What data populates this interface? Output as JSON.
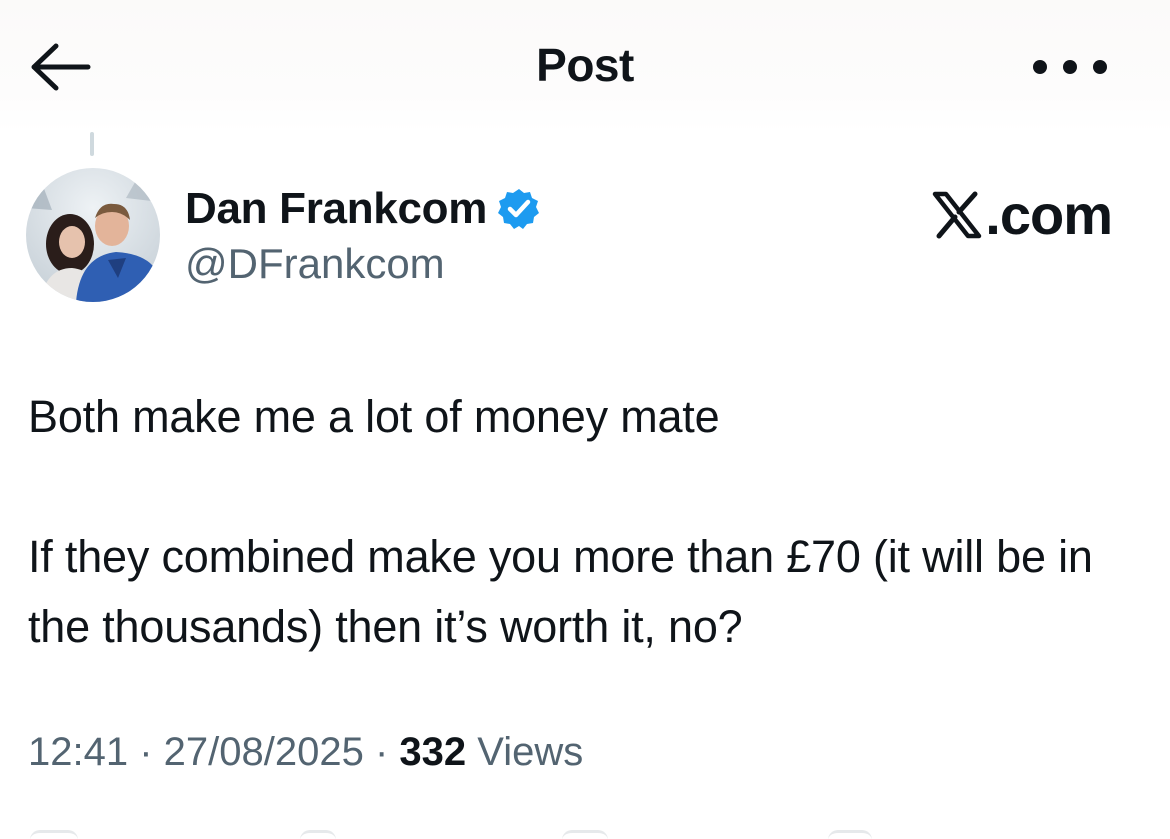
{
  "header": {
    "title": "Post",
    "back_icon": "arrow-left-icon",
    "more_icon": "ellipsis-icon"
  },
  "author": {
    "display_name": "Dan Frankcom",
    "handle": "@DFrankcom",
    "verified": true,
    "verified_color": "#1d9bf0"
  },
  "watermark": {
    "text": ".com",
    "logo_icon": "x-logo-icon"
  },
  "tweet": {
    "paragraphs": [
      "Both make me a lot of money mate",
      "If they combined make you more than £70 (it will be in the thousands) then it’s worth it, no?"
    ]
  },
  "meta": {
    "time": "12:41",
    "separator": " · ",
    "date": "27/08/2025",
    "views_count": "332",
    "views_label": " Views"
  },
  "colors": {
    "text_primary": "#0f1419",
    "text_secondary": "#536471",
    "accent": "#1d9bf0"
  }
}
